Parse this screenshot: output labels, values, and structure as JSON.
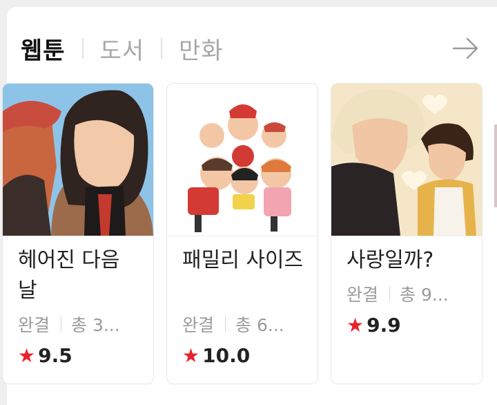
{
  "tabs": [
    {
      "label": "웹툰",
      "active": true
    },
    {
      "label": "도서",
      "active": false
    },
    {
      "label": "만화",
      "active": false
    }
  ],
  "more_icon": "arrow-right-icon",
  "cards": [
    {
      "title": "헤어진 다음 날",
      "status": "완결",
      "count": "총 3...",
      "star": "★",
      "rating": "9.5"
    },
    {
      "title": "패밀리 사이즈",
      "status": "완결",
      "count": "총 6...",
      "star": "★",
      "rating": "10.0"
    },
    {
      "title": "사랑일까?",
      "status": "완결",
      "count": "총 9...",
      "star": "★",
      "rating": "9.9"
    }
  ],
  "colors": {
    "accent_star": "#e8222c",
    "active_tab": "#111111",
    "inactive_tab": "#a8a8a8"
  }
}
